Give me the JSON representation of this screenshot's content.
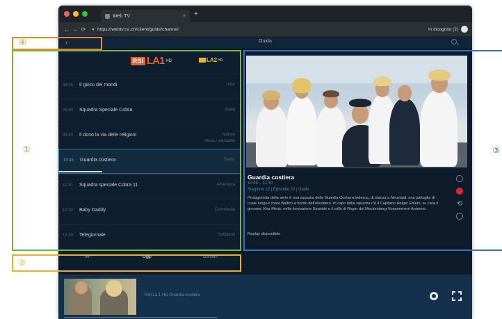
{
  "browser": {
    "tab_title": "Web TV",
    "tab_close": "×",
    "new_tab": "+",
    "url": "https://webtv.rsi.ch/client/guide/channel",
    "incognito_label": "In incognito (2)",
    "nav": {
      "back": "←",
      "forward": "→",
      "reload": "⟳"
    },
    "traffic_colors": [
      "#ff5f57",
      "#febc2e",
      "#28c840"
    ]
  },
  "app": {
    "header_title": "Guida",
    "back_glyph": "‹"
  },
  "channels": {
    "primary": {
      "brand": "RSI",
      "name": "LA1",
      "tag": "HD"
    },
    "secondary": {
      "name": "LA2",
      "tag": "HD"
    }
  },
  "programs": [
    {
      "time": "06:35",
      "title": "Il gioco dei mondi",
      "genre": "Infor",
      "sub": "",
      "active": false
    },
    {
      "time": "08:50",
      "title": "Squadra Speciale Cobra",
      "genre": "Giallo",
      "sub": "",
      "active": false
    },
    {
      "time": "09:40",
      "title": "Il dono la via delle religioni",
      "genre": "Natura",
      "sub": "Storia / spiritualità",
      "active": false
    },
    {
      "time": "10:45",
      "title": "Guardia costiera",
      "genre": "Giallo",
      "sub": "",
      "active": true
    },
    {
      "time": "11:30",
      "title": "Squadra speciale Cobra 11",
      "genre": "Avventura",
      "sub": "",
      "active": false
    },
    {
      "time": "12:30",
      "title": "Baby Daddy",
      "genre": "Commedia",
      "sub": "",
      "active": false
    },
    {
      "time": "12:50",
      "title": "Telegiornale",
      "genre": "Notiziario",
      "sub": "",
      "active": false
    }
  ],
  "days": {
    "prev": "Ieri",
    "current": "Oggi",
    "next": "Domani"
  },
  "detail": {
    "title": "Guardia costiera",
    "time": "10:45 – 11:30",
    "meta": "Stagione 12 | Episodio 20 | Giallo",
    "description": "Protagonista della serie è una squadra della Guardia Costiera tedesca, di stanza a Neustadt: una pattuglia di coste lungo il mare Baltico a bordo dell'elicottero. In capo della squadra c'è il Capitano Holger Ehlers, su cara è giovane, Kira Mertz, nella formazione Seaside e il collo di Roger del Meckenberg-Vorpommern Antenne.",
    "availability": "Replay disponibile"
  },
  "player": {
    "now_playing": "RSI La 1 HD Guardia costiera"
  },
  "annotations": {
    "guide": "①",
    "days": "②",
    "detail": "③",
    "back": "④",
    "colors": {
      "guide": "#7cb340",
      "detail": "#3f6fb4",
      "back": "#e08a2a",
      "days": "#efb020"
    }
  },
  "icons": [
    "back-icon",
    "search-icon",
    "info-icon",
    "record-icon",
    "restart-icon",
    "more-icon",
    "settings-icon",
    "fullscreen-icon",
    "lock-icon"
  ]
}
